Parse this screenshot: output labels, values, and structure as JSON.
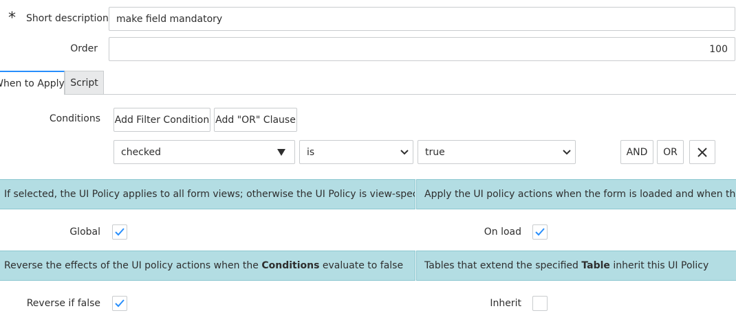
{
  "form": {
    "short_description": {
      "label": "Short description",
      "value": "make field mandatory",
      "required_marker": "*"
    },
    "order": {
      "label": "Order",
      "value": "100"
    }
  },
  "tabs": [
    {
      "label": "When to Apply",
      "active": true
    },
    {
      "label": "Script",
      "active": false
    }
  ],
  "conditions": {
    "label": "Conditions",
    "add_filter_label": "Add Filter Condition",
    "add_or_label": "Add \"OR\" Clause",
    "row": {
      "field": "checked",
      "operator": "is",
      "value": "true",
      "and_label": "AND",
      "or_label": "OR"
    }
  },
  "info": {
    "global_pre": "If selected, the UI Policy applies to all form views; otherwise the UI Policy is view-specific",
    "onload_pre": "Apply the UI policy actions when the form is loaded and when the user chang",
    "reverse_pre": "Reverse the effects of the UI policy actions when the ",
    "reverse_bold": "Conditions",
    "reverse_post": " evaluate to false",
    "inherit_pre": "Tables that extend the specified ",
    "inherit_bold": "Table",
    "inherit_post": " inherit this UI Policy"
  },
  "checkboxes": {
    "global": {
      "label": "Global",
      "checked": true
    },
    "on_load": {
      "label": "On load",
      "checked": true
    },
    "reverse_if_false": {
      "label": "Reverse if false",
      "checked": true
    },
    "inherit": {
      "label": "Inherit",
      "checked": false
    }
  },
  "icons": {
    "required": "asterisk-icon",
    "dropdown": "chevron-down-icon",
    "check": "check-icon",
    "remove": "close-icon",
    "field_caret": "triangle-down-icon"
  },
  "colors": {
    "info_bg": "#b3dde3",
    "check": "#278efc",
    "text": "#2e2e2e",
    "border": "#c9ccce"
  }
}
